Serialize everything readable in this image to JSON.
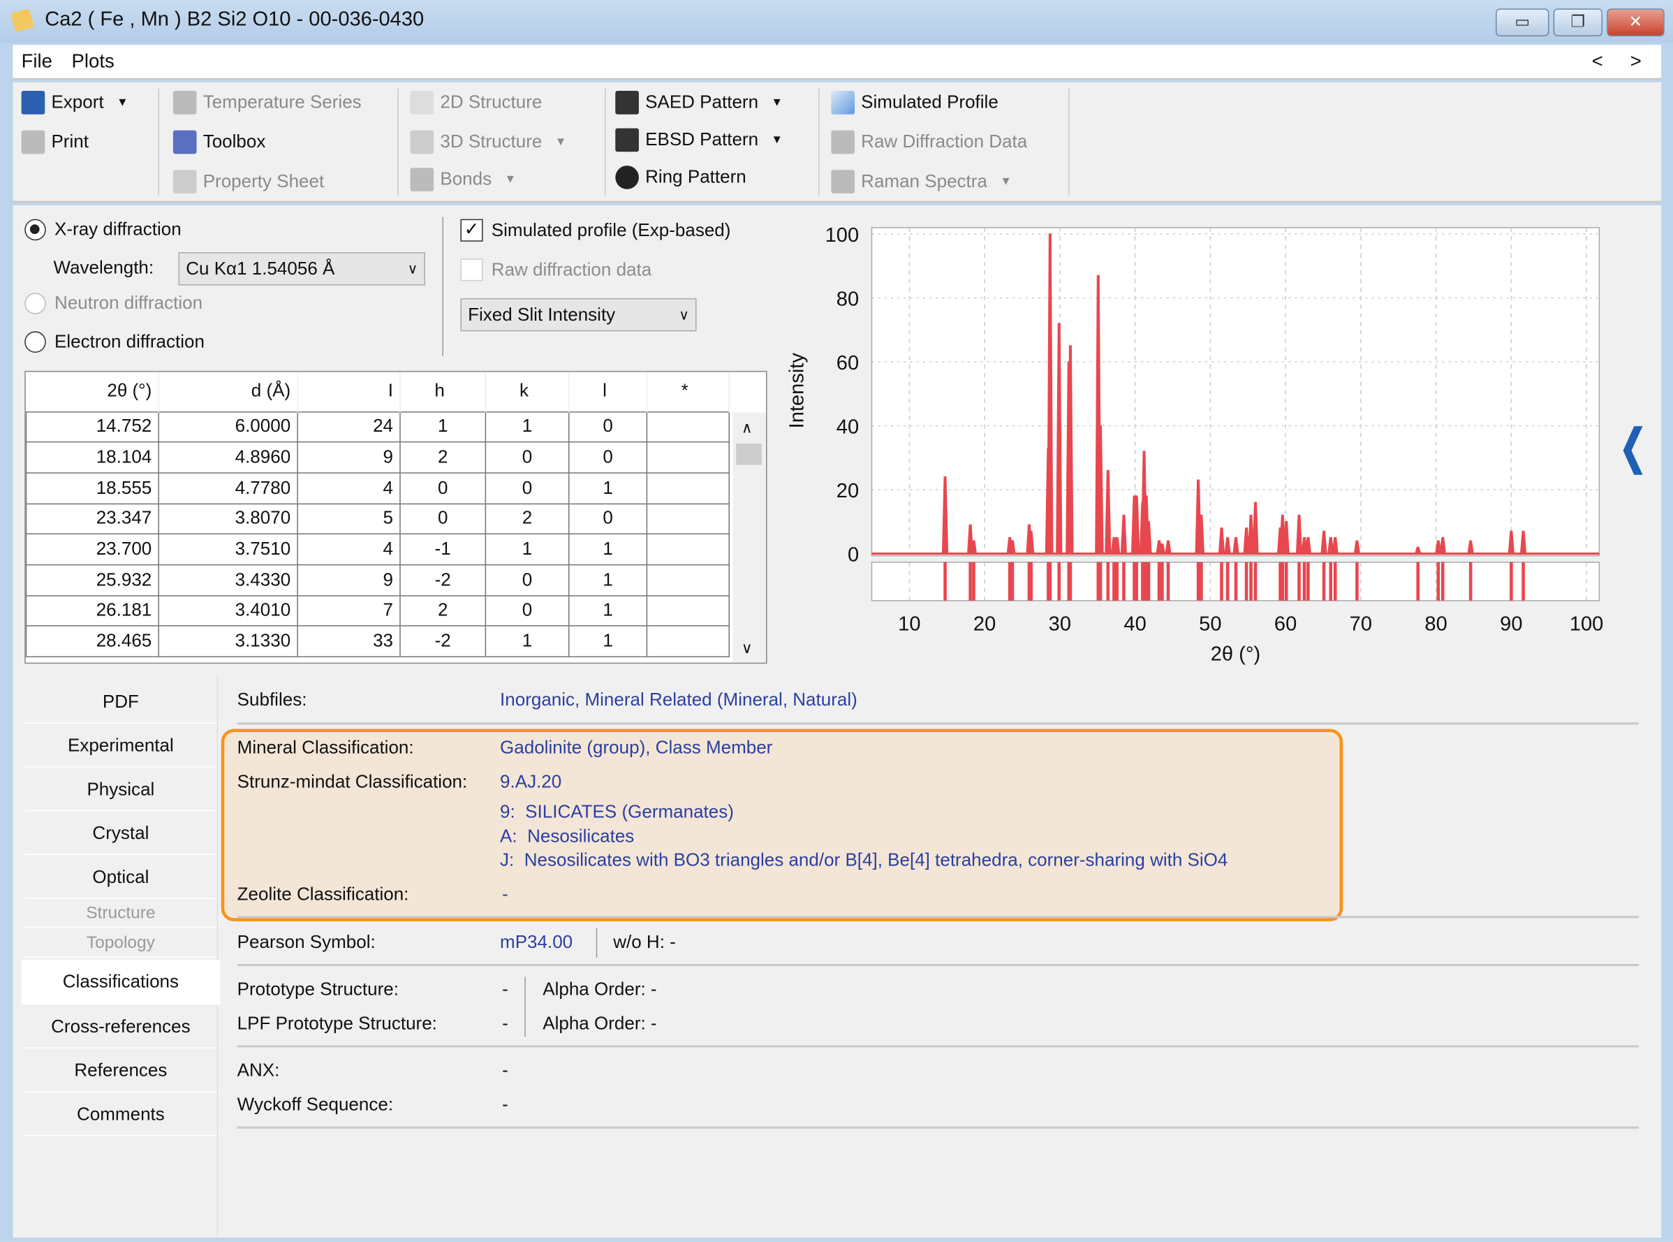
{
  "window": {
    "title": "Ca2 ( Fe , Mn ) B2 Si2 O10 - 00-036-0430",
    "minimize": "▭",
    "maximize": "❐",
    "close": "✕"
  },
  "menu": {
    "items": [
      "File",
      "Plots"
    ],
    "prev": "<",
    "next": ">"
  },
  "toolbar": {
    "export": "Export",
    "print": "Print",
    "temperature_series": "Temperature Series",
    "toolbox": "Toolbox",
    "property_sheet": "Property Sheet",
    "structure_2d": "2D Structure",
    "structure_3d": "3D Structure",
    "bonds": "Bonds",
    "saed": "SAED Pattern",
    "ebsd": "EBSD Pattern",
    "ring": "Ring Pattern",
    "simulated_profile": "Simulated Profile",
    "raw_diffraction": "Raw Diffraction Data",
    "raman": "Raman Spectra"
  },
  "options": {
    "xray": "X-ray diffraction",
    "wavelength_label": "Wavelength:",
    "wavelength_value": "Cu Kα1 1.54056 Å",
    "neutron": "Neutron diffraction",
    "electron": "Electron diffraction",
    "simulated_profile": "Simulated profile (Exp-based)",
    "simulated_checked": true,
    "raw_data": "Raw diffraction data",
    "raw_checked": false,
    "intensity_mode": "Fixed Slit Intensity"
  },
  "peak_table": {
    "headers": [
      "2θ (°)",
      "d (Å)",
      "I",
      "h",
      "k",
      "l",
      "*"
    ],
    "rows": [
      [
        "14.752",
        "6.0000",
        "24",
        "1",
        "1",
        "0",
        ""
      ],
      [
        "18.104",
        "4.8960",
        "9",
        "2",
        "0",
        "0",
        ""
      ],
      [
        "18.555",
        "4.7780",
        "4",
        "0",
        "0",
        "1",
        ""
      ],
      [
        "23.347",
        "3.8070",
        "5",
        "0",
        "2",
        "0",
        ""
      ],
      [
        "23.700",
        "3.7510",
        "4",
        "-1",
        "1",
        "1",
        ""
      ],
      [
        "25.932",
        "3.4330",
        "9",
        "-2",
        "0",
        "1",
        ""
      ],
      [
        "26.181",
        "3.4010",
        "7",
        "2",
        "0",
        "1",
        ""
      ],
      [
        "28.465",
        "3.1330",
        "33",
        "-2",
        "1",
        "1",
        ""
      ]
    ]
  },
  "chart_data": {
    "type": "line",
    "xlabel": "2θ (°)",
    "ylabel": "Intensity",
    "xlim": [
      5,
      101.7
    ],
    "ylim": [
      0,
      102
    ],
    "xticks": [
      10,
      20,
      30,
      40,
      50,
      60,
      70,
      80,
      90,
      100
    ],
    "yticks": [
      0,
      20,
      40,
      60,
      80,
      100
    ],
    "grid": true,
    "color": "#e8474f",
    "peaks": [
      [
        14.75,
        24
      ],
      [
        18.1,
        9
      ],
      [
        18.55,
        4
      ],
      [
        23.35,
        5
      ],
      [
        23.7,
        4
      ],
      [
        25.93,
        9
      ],
      [
        26.18,
        7
      ],
      [
        28.47,
        33
      ],
      [
        28.7,
        100
      ],
      [
        29.9,
        72
      ],
      [
        31.2,
        60
      ],
      [
        31.4,
        65
      ],
      [
        35.1,
        87
      ],
      [
        35.4,
        40
      ],
      [
        36.4,
        26
      ],
      [
        37.2,
        5
      ],
      [
        37.6,
        5
      ],
      [
        38.5,
        12
      ],
      [
        39.9,
        18
      ],
      [
        40.2,
        18
      ],
      [
        41.0,
        16
      ],
      [
        41.2,
        32
      ],
      [
        41.5,
        18
      ],
      [
        41.8,
        10
      ],
      [
        43.2,
        4
      ],
      [
        43.6,
        3
      ],
      [
        44.4,
        4
      ],
      [
        48.4,
        23
      ],
      [
        48.8,
        12
      ],
      [
        51.5,
        8
      ],
      [
        52.3,
        5
      ],
      [
        53.4,
        5
      ],
      [
        54.8,
        8
      ],
      [
        55.4,
        12
      ],
      [
        56.0,
        16
      ],
      [
        59.3,
        8
      ],
      [
        59.6,
        12
      ],
      [
        60.1,
        10
      ],
      [
        61.8,
        12
      ],
      [
        62.5,
        5
      ],
      [
        63.0,
        5
      ],
      [
        65.1,
        7
      ],
      [
        66.0,
        5
      ],
      [
        66.6,
        5
      ],
      [
        69.5,
        4
      ],
      [
        77.6,
        2
      ],
      [
        80.3,
        4
      ],
      [
        80.9,
        5
      ],
      [
        84.6,
        4
      ],
      [
        90.0,
        7
      ],
      [
        91.6,
        7
      ]
    ]
  },
  "tabs": [
    "PDF",
    "Experimental",
    "Physical",
    "Crystal",
    "Optical",
    "Structure",
    "Topology",
    "Classifications",
    "Cross-references",
    "References",
    "Comments"
  ],
  "classifications": {
    "subfiles_label": "Subfiles:",
    "subfiles": "Inorganic, Mineral Related (Mineral, Natural)",
    "mineral_label": "Mineral Classification:",
    "mineral": "Gadolinite (group), Class Member",
    "strunz_label": "Strunz-mindat Classification:",
    "strunz": "9.AJ.20",
    "strunz_lines": [
      "9:  SILICATES (Germanates)",
      "A:  Nesosilicates",
      "J:  Nesosilicates with BO3 triangles and/or B[4], Be[4] tetrahedra, corner-sharing with SiO4"
    ],
    "zeolite_label": "Zeolite Classification:",
    "zeolite": "-",
    "pearson_label": "Pearson Symbol:",
    "pearson": "mP34.00",
    "woh": "w/o H: -",
    "prototype_label": "Prototype Structure:",
    "prototype": "-",
    "alpha1": "Alpha Order: -",
    "lpf_label": "LPF Prototype Structure:",
    "lpf": "-",
    "alpha2": "Alpha Order: -",
    "anx_label": "ANX:",
    "anx": "-",
    "wyckoff_label": "Wyckoff Sequence:",
    "wyckoff": "-",
    "highlight_color": "#f7941d"
  }
}
